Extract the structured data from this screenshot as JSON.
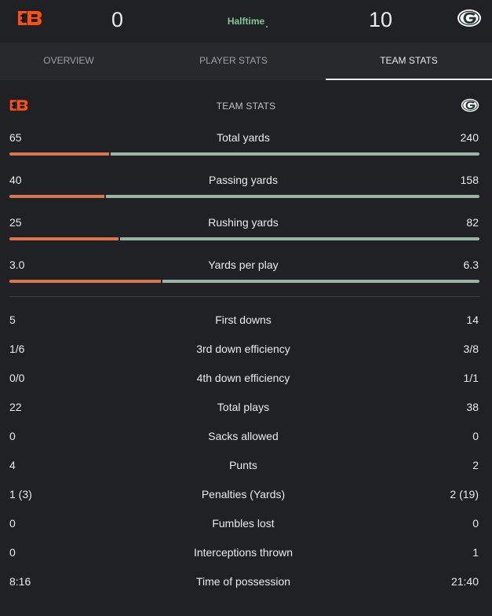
{
  "header": {
    "home_team_icon": "bengals-logo",
    "away_team_icon": "packers-logo",
    "home_score": "0",
    "away_score": "10",
    "status": "Halftime"
  },
  "tabs": [
    {
      "label": "OVERVIEW",
      "active": false
    },
    {
      "label": "PLAYER STATS",
      "active": false
    },
    {
      "label": "TEAM STATS",
      "active": true
    }
  ],
  "section": {
    "title": "TEAM STATS"
  },
  "bar_stats": [
    {
      "label": "Total yards",
      "home": "65",
      "away": "240"
    },
    {
      "label": "Passing yards",
      "home": "40",
      "away": "158"
    },
    {
      "label": "Rushing yards",
      "home": "25",
      "away": "82"
    },
    {
      "label": "Yards per play",
      "home": "3.0",
      "away": "6.3"
    }
  ],
  "stats": [
    {
      "label": "First downs",
      "home": "5",
      "away": "14"
    },
    {
      "label": "3rd down efficiency",
      "home": "1/6",
      "away": "3/8"
    },
    {
      "label": "4th down efficiency",
      "home": "0/0",
      "away": "1/1"
    },
    {
      "label": "Total plays",
      "home": "22",
      "away": "38"
    },
    {
      "label": "Sacks allowed",
      "home": "0",
      "away": "0"
    },
    {
      "label": "Punts",
      "home": "4",
      "away": "2"
    },
    {
      "label": "Penalties (Yards)",
      "home": "1 (3)",
      "away": "2 (19)"
    },
    {
      "label": "Fumbles lost",
      "home": "0",
      "away": "0"
    },
    {
      "label": "Interceptions thrown",
      "home": "0",
      "away": "1"
    },
    {
      "label": "Time of possession",
      "home": "8:16",
      "away": "21:40"
    }
  ],
  "colors": {
    "background": "#202124",
    "tabs_background": "#28292c",
    "status_green": "#81c995",
    "home_bar": "#d9764f",
    "away_bar": "#9bb3a3",
    "bengals_orange": "#fb4f14",
    "packers_green": "#203731",
    "packers_gold": "#ffb612"
  }
}
